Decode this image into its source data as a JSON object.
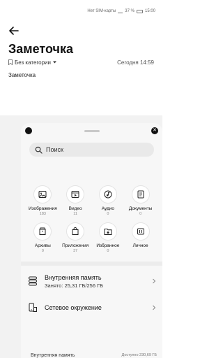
{
  "status_bar": {
    "left_text": "",
    "right_text": "Нет SIM-карты",
    "battery": "37 %",
    "time": "15:00"
  },
  "note": {
    "title": "Заметочка",
    "category": "Без категории",
    "date": "Сегодня 14:59",
    "body": "Заметочка"
  },
  "picker": {
    "search_placeholder": "Поиск",
    "categories": [
      {
        "label": "Изображения",
        "count": "183",
        "icon": "image-icon"
      },
      {
        "label": "Видео",
        "count": "11",
        "icon": "video-icon"
      },
      {
        "label": "Аудио",
        "count": "0",
        "icon": "music-icon"
      },
      {
        "label": "Документы",
        "count": "0",
        "icon": "document-icon"
      },
      {
        "label": "Архивы",
        "count": "0",
        "icon": "archive-icon"
      },
      {
        "label": "Приложения",
        "count": "37",
        "icon": "apps-icon"
      },
      {
        "label": "Избранное",
        "count": "0",
        "icon": "star-folder-icon"
      },
      {
        "label": "Личное",
        "count": "",
        "icon": "private-icon"
      }
    ],
    "internal_storage": {
      "title": "Внутренняя память",
      "subtitle": "Занято: 25,31 ГБ/256 ГБ"
    },
    "network": {
      "title": "Сетевое окружение"
    },
    "bottom": {
      "title": "Внутренняя память",
      "right": "Доступно 230,69 ГБ"
    }
  }
}
